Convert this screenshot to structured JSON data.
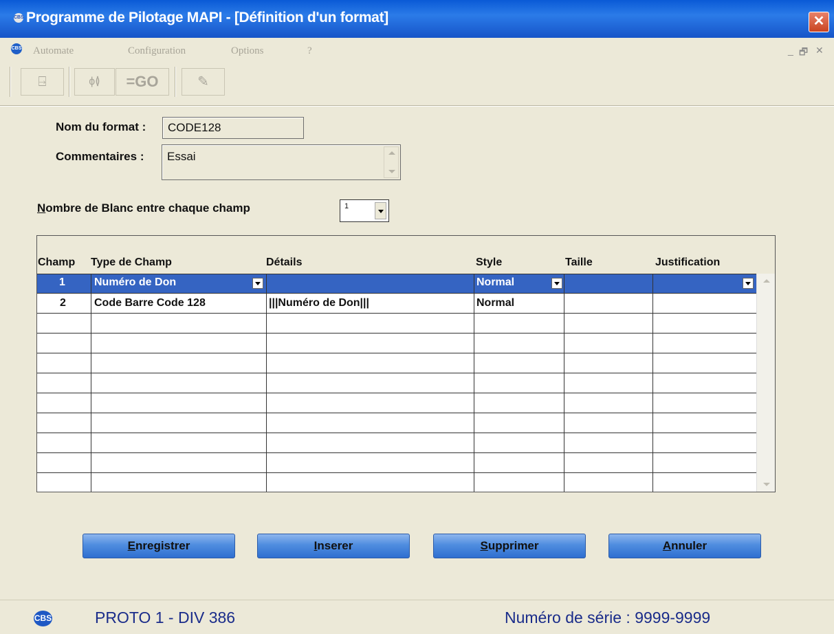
{
  "window": {
    "icon_text": "CBS",
    "title": "Programme de Pilotage MAPI - [Définition d'un format]",
    "close_glyph": "✕"
  },
  "menu": {
    "app_icon_text": "CBS",
    "items": [
      {
        "label": "Automate"
      },
      {
        "label": "Configuration"
      },
      {
        "label": "Options"
      },
      {
        "label": "?"
      }
    ],
    "min_glyph": "_",
    "restore_glyph": "🗗",
    "close_glyph": "✕"
  },
  "toolbar": {
    "buttons": [
      {
        "name": "exit-door-icon",
        "glyph": "⍈"
      },
      {
        "name": "settings-icon",
        "glyph": "ϕ≬"
      },
      {
        "name": "go-icon",
        "glyph": "=GO"
      },
      {
        "name": "edit-icon",
        "glyph": "✎"
      }
    ]
  },
  "form": {
    "nom_label": "Nom du format :",
    "nom_value": "CODE128",
    "comment_label": "Commentaires :",
    "comment_value": "Essai",
    "blanc_label_first": "N",
    "blanc_label_rest": "ombre de Blanc entre chaque champ",
    "blanc_value": "1"
  },
  "grid": {
    "columns": [
      "Champ",
      "Type de Champ",
      "Détails",
      "Style",
      "Taille",
      "Justification"
    ],
    "rows": [
      {
        "champ": "1",
        "type": "Numéro de Don",
        "details": "",
        "style": "Normal",
        "taille": "",
        "justification": ""
      },
      {
        "champ": "2",
        "type": "Code Barre  Code 128",
        "details": "|||Numéro de Don|||",
        "style": "Normal",
        "taille": "",
        "justification": ""
      }
    ]
  },
  "buttons": {
    "enregistrer_first": "E",
    "enregistrer_rest": "nregistrer",
    "inserer_first": "I",
    "inserer_rest": "nserer",
    "supprimer_first": "S",
    "supprimer_rest": "upprimer",
    "annuler_first": "A",
    "annuler_rest": "nnuler"
  },
  "status": {
    "logo_text": "CBS",
    "left": "PROTO 1 - DIV 386",
    "right": "Numéro de série : 9999-9999"
  },
  "colors": {
    "titlebar": "#1654c8",
    "selection": "#3564c2",
    "button": "#4f8ddf",
    "status_text": "#1a2c8a",
    "background": "#ece9d8"
  }
}
